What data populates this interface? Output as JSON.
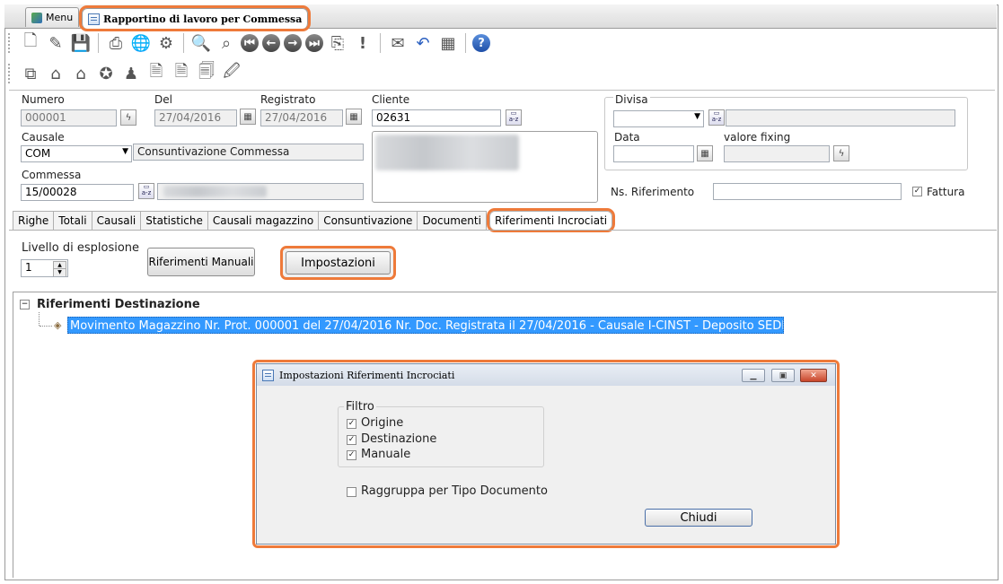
{
  "tabs": {
    "menu": "Menu",
    "active": "Rapportino di lavoro per Commessa"
  },
  "header": {
    "numero_label": "Numero",
    "numero_value": "000001",
    "del_label": "Del",
    "del_value": "27/04/2016",
    "registrato_label": "Registrato",
    "registrato_value": "27/04/2016",
    "cliente_label": "Cliente",
    "cliente_value": "02631",
    "causale_label": "Causale",
    "causale_value": "COM",
    "causale_desc": "Consuntivazione Commessa",
    "commessa_label": "Commessa",
    "commessa_value": "15/00028",
    "divisa_label": "Divisa",
    "data_label": "Data",
    "valore_fixing_label": "valore fixing",
    "ns_riferimento_label": "Ns. Riferimento",
    "fattura_label": "Fattura",
    "fattura_checked": true
  },
  "section_tabs": [
    "Righe",
    "Totali",
    "Causali",
    "Statistiche",
    "Causali magazzino",
    "Consuntivazione",
    "Documenti",
    "Riferimenti Incrociati"
  ],
  "active_section_tab": "Riferimenti Incrociati",
  "riferimenti": {
    "livello_label": "Livello di esplosione",
    "livello_value": "1",
    "riferimenti_manuali_button": "Riferimenti Manuali",
    "impostazioni_button": "Impostazioni",
    "tree_root": "Riferimenti Destinazione",
    "tree_item": "Movimento Magazzino Nr. Prot. 000001 del 27/04/2016 Nr. Doc.  Registrata il 27/04/2016  - Causale I-CINST - Deposito SEDE"
  },
  "dialog": {
    "title": "Impostazioni Riferimenti Incrociati",
    "filtro_label": "Filtro",
    "filters": [
      {
        "label": "Origine",
        "checked": true
      },
      {
        "label": "Destinazione",
        "checked": true
      },
      {
        "label": "Manuale",
        "checked": true
      }
    ],
    "raggruppa_label": "Raggruppa per Tipo Documento",
    "raggruppa_checked": false,
    "chiudi_button": "Chiudi"
  },
  "colors": {
    "highlight": "#ee7a3a",
    "selection": "#3399ff"
  }
}
